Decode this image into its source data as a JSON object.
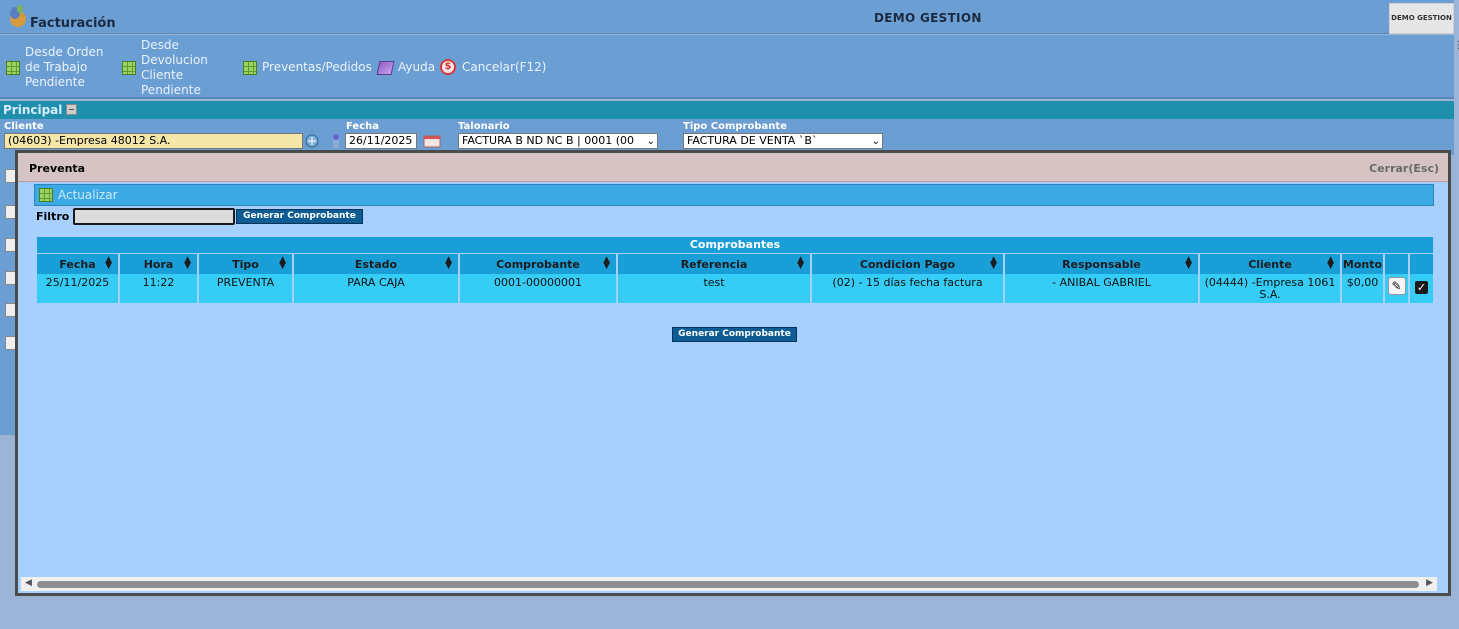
{
  "header": {
    "app_title": "Facturación",
    "company": "DEMO GESTION",
    "logo_text": "DEMO GESTION"
  },
  "toolbar": {
    "items": [
      {
        "label": "Desde Orden de Trabajo Pendiente",
        "icon": "grid-icon"
      },
      {
        "label": "Desde Devolucion Cliente Pendiente",
        "icon": "grid-icon"
      },
      {
        "label": "Preventas/Pedidos",
        "icon": "grid-icon"
      },
      {
        "label": "Ayuda",
        "icon": "book-icon"
      },
      {
        "label": "Cancelar(F12)",
        "icon": "cancel-icon"
      }
    ]
  },
  "principal": {
    "title": "Principal",
    "cliente_label": "Cliente",
    "cliente_value": "(04603) -Empresa 48012 S.A.",
    "fecha_label": "Fecha",
    "fecha_value": "26/11/2025",
    "talonario_label": "Talonario",
    "talonario_value": "FACTURA B ND NC B | 0001 (00",
    "tipo_label": "Tipo Comprobante",
    "tipo_value": "FACTURA DE VENTA `B`"
  },
  "modal": {
    "title": "Preventa",
    "close_label": "Cerrar(Esc)",
    "refresh_label": "Actualizar",
    "filter_label": "Filtro",
    "filter_value": "",
    "generate_label": "Generar Comprobante",
    "table_title": "Comprobantes",
    "columns": [
      "Fecha",
      "Hora",
      "Tipo",
      "Estado",
      "Comprobante",
      "Referencia",
      "Condicion Pago",
      "Responsable",
      "Cliente",
      "Monto"
    ],
    "rows": [
      {
        "fecha": "25/11/2025",
        "hora": "11:22",
        "tipo": "PREVENTA",
        "estado": "PARA CAJA",
        "comprobante": "0001-00000001",
        "referencia": "test",
        "condicion": "(02) - 15 días fecha factura",
        "responsable": "- ANIBAL GABRIEL",
        "cliente": "(04444) -Empresa 1061 S.A.",
        "monto": "$0,00",
        "checked": true
      }
    ]
  },
  "colors": {
    "header_bg": "#6b9fd4",
    "principal_bar": "#1f8fae",
    "modal_bg": "#a8d0ff",
    "table_header": "#1a9ed8",
    "table_row": "#35cdf6",
    "button_bg": "#0d5c94"
  }
}
